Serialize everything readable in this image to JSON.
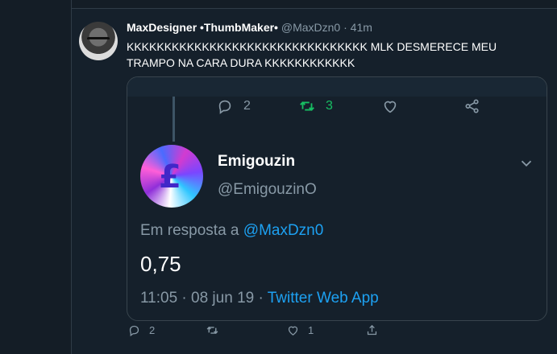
{
  "tweet": {
    "author_name": "MaxDesigner •ThumbMaker•",
    "author_handle": "@MaxDzn0",
    "separator": "·",
    "time": "41m",
    "text": "KKKKKKKKKKKKKKKKKKKKKKKKKKKKKKKK MLK DESMERECE MEU TRAMPO NA CARA DURA KKKKKKKKKKKK"
  },
  "quoted": {
    "actions": {
      "reply_count": "2",
      "retweet_count": "3"
    },
    "author_name": "Emigouzin",
    "author_handle": "@EmigouzinO",
    "reply_prefix": "Em resposta a",
    "reply_mention": "@MaxDzn0",
    "text": "0,75",
    "timestamp": "11:05 · 08 jun 19 ·",
    "source": "Twitter Web App"
  },
  "actions": {
    "reply_count": "2",
    "like_count": "1"
  },
  "icons": {
    "reply": "reply-icon",
    "retweet": "retweet-icon",
    "like": "like-icon",
    "share": "share-icon",
    "chevron": "chevron-down-icon"
  },
  "colors": {
    "background": "#15202b",
    "border": "#38444d",
    "muted_text": "#8899a6",
    "link_blue": "#1da1f2",
    "retweet_green": "#17bf63"
  }
}
